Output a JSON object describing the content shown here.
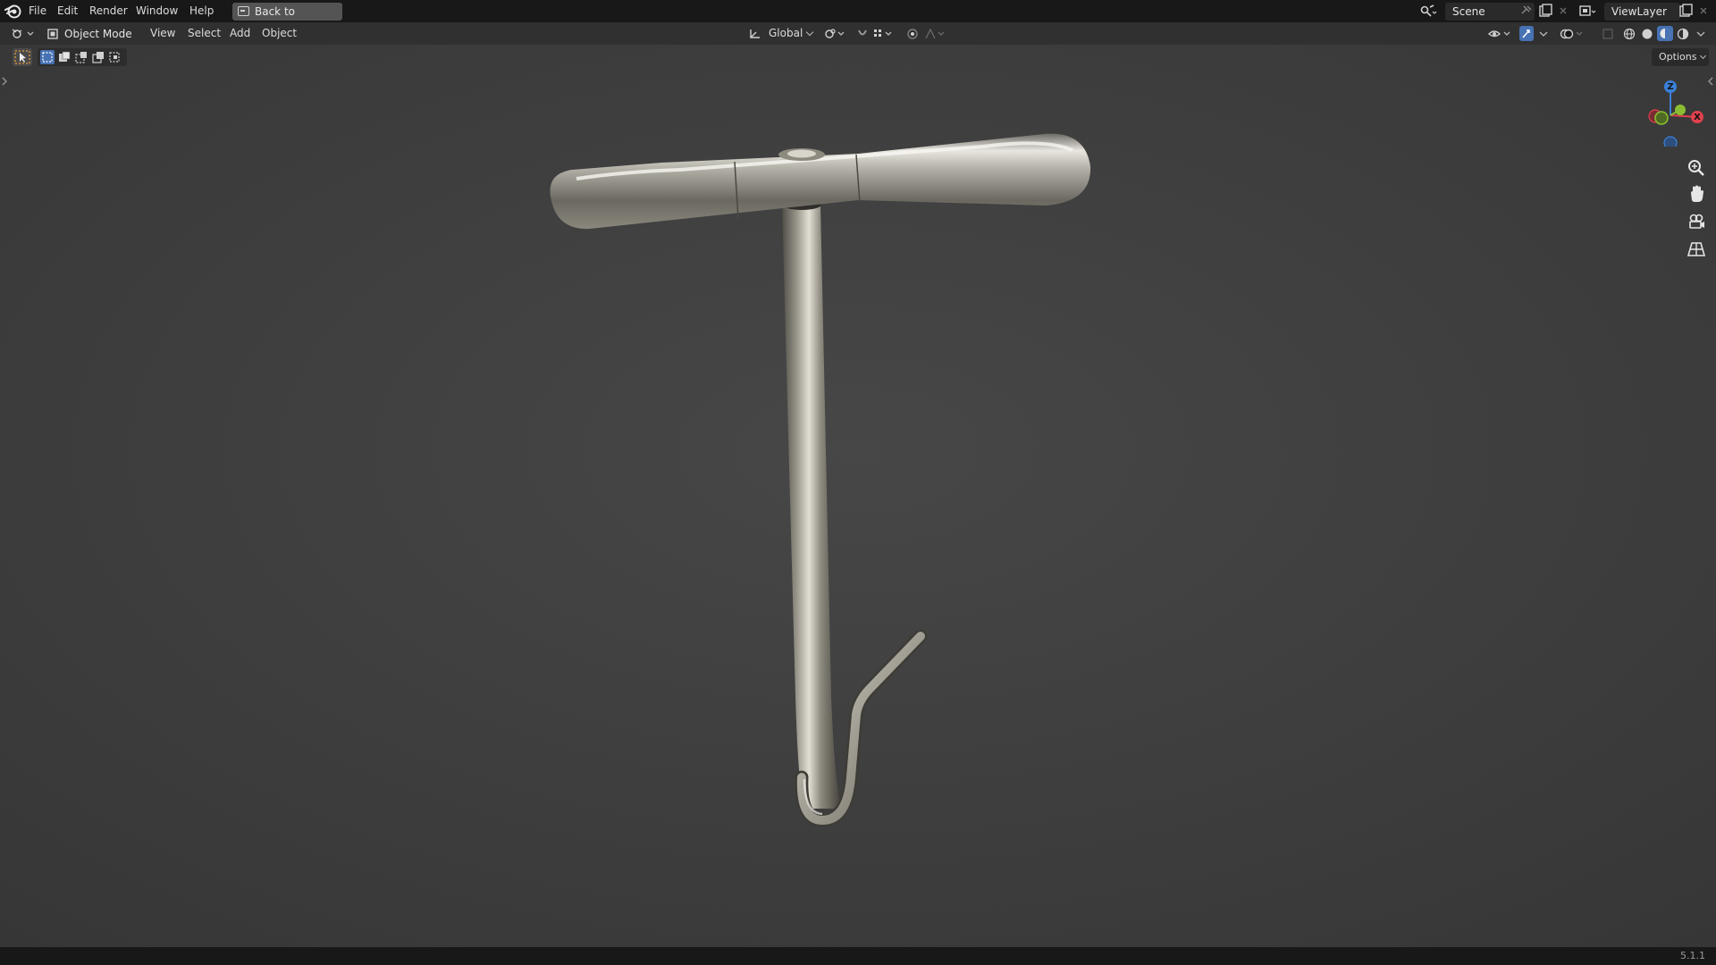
{
  "menubar": {
    "items": [
      "File",
      "Edit",
      "Render",
      "Window",
      "Help"
    ],
    "back_button": "Back to Previous",
    "scene_name": "Scene",
    "view_layer_name": "ViewLayer"
  },
  "header": {
    "mode": "Object Mode",
    "menus": [
      "View",
      "Select",
      "Add",
      "Object"
    ],
    "transform_orientation": "Global"
  },
  "toolbar": {
    "options_label": "Options"
  },
  "gizmo": {
    "axes": [
      "Z",
      "X"
    ],
    "colors": {
      "x": "#e0414e",
      "y": "#8bbd32",
      "z": "#3b80d8"
    }
  },
  "statusbar": {
    "version": "5.1.1"
  },
  "viewport": {
    "background": "#3d3d3d",
    "object": "t-handle-hook"
  }
}
